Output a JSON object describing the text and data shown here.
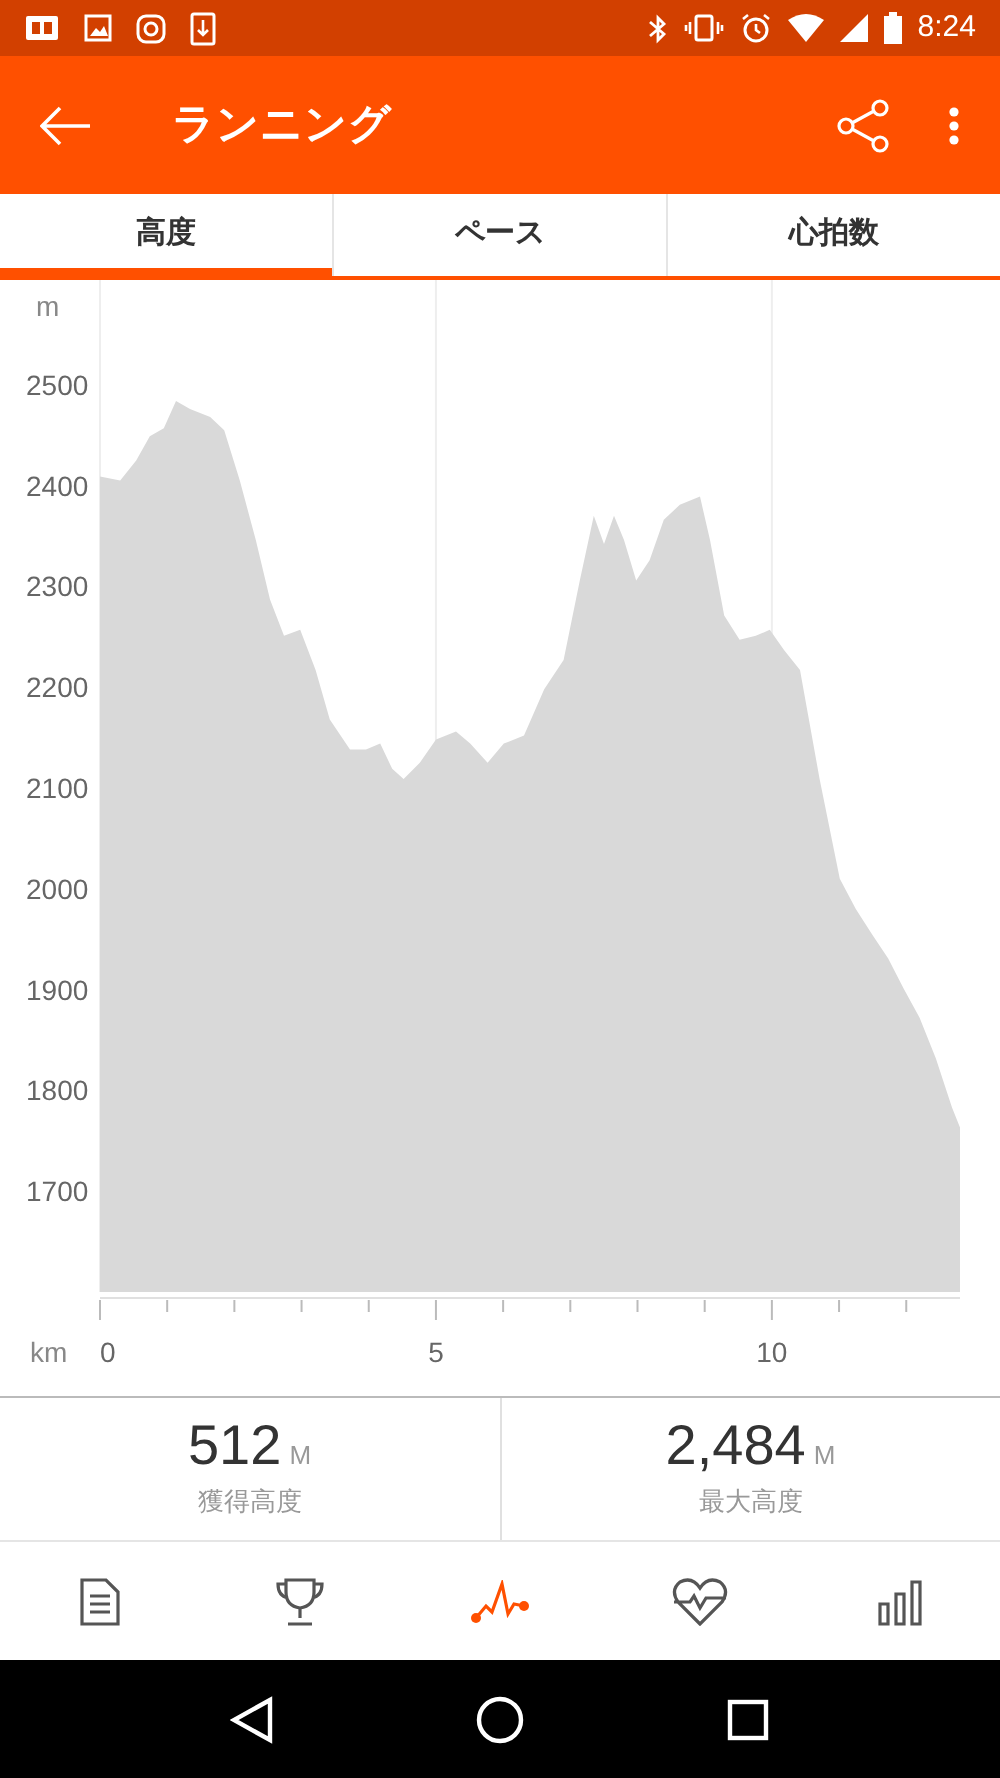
{
  "status_bar": {
    "time": "8:24"
  },
  "app_bar": {
    "title": "ランニング"
  },
  "tabs": [
    {
      "label": "高度",
      "selected": true
    },
    {
      "label": "ペース",
      "selected": false
    },
    {
      "label": "心拍数",
      "selected": false
    }
  ],
  "chart": {
    "unit": "m",
    "x_unit": "km",
    "chart_data": {
      "type": "area",
      "x": [
        0,
        0.3,
        0.54,
        0.74,
        0.95,
        1.13,
        1.34,
        1.64,
        1.85,
        2.08,
        2.32,
        2.53,
        2.74,
        2.98,
        3.21,
        3.42,
        3.72,
        3.96,
        4.17,
        4.35,
        4.52,
        4.76,
        5.0,
        5.3,
        5.51,
        5.77,
        6.01,
        6.31,
        6.61,
        6.9,
        7.14,
        7.35,
        7.5,
        7.65,
        7.8,
        7.98,
        8.18,
        8.39,
        8.63,
        8.93,
        9.08,
        9.29,
        9.52,
        9.76,
        9.97,
        10.18,
        10.42,
        10.71,
        11.01,
        11.25,
        11.49,
        11.73,
        11.96,
        12.2,
        12.44,
        12.68,
        12.8
      ],
      "series": [
        {
          "color": "#d9d9d9",
          "values": [
            2409,
            2405,
            2425,
            2449,
            2457,
            2484,
            2476,
            2468,
            2455,
            2405,
            2346,
            2287,
            2251,
            2257,
            2217,
            2168,
            2138,
            2138,
            2144,
            2119,
            2109,
            2125,
            2148,
            2156,
            2144,
            2125,
            2144,
            2152,
            2198,
            2227,
            2306,
            2370,
            2342,
            2370,
            2346,
            2306,
            2326,
            2366,
            2381,
            2389,
            2346,
            2271,
            2247,
            2251,
            2257,
            2237,
            2217,
            2109,
            2010,
            1980,
            1955,
            1931,
            1901,
            1872,
            1832,
            1783,
            1763
          ]
        }
      ],
      "xlim": [
        0,
        12.8
      ],
      "ylim": [
        1600,
        2600
      ],
      "xticks": [
        0,
        5,
        10
      ],
      "yticks": [
        1700,
        1800,
        1900,
        2000,
        2100,
        2200,
        2300,
        2400,
        2500
      ]
    }
  },
  "stats": [
    {
      "value": "512",
      "unit": "M",
      "label": "獲得高度"
    },
    {
      "value": "2,484",
      "unit": "M",
      "label": "最大高度"
    }
  ],
  "bottom_nav": [
    {
      "kind": "summary",
      "selected": false
    },
    {
      "kind": "trophy",
      "selected": false
    },
    {
      "kind": "elevation",
      "selected": true
    },
    {
      "kind": "heart",
      "selected": false
    },
    {
      "kind": "stats",
      "selected": false
    }
  ]
}
